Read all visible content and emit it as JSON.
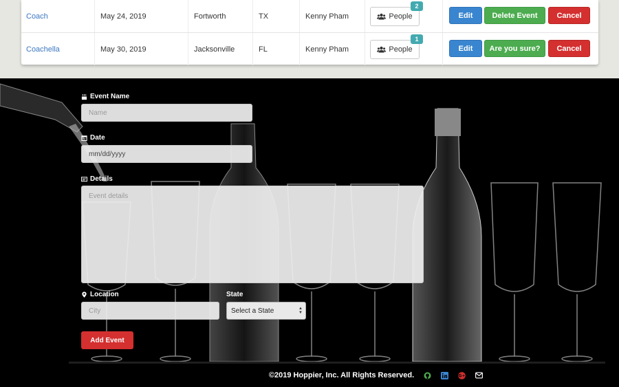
{
  "table": {
    "rows": [
      {
        "name": "Coach",
        "date": "May 24, 2019",
        "city": "Fortworth",
        "state": "TX",
        "host": "Kenny Pham",
        "people_label": "People",
        "people_count": "2",
        "edit_label": "Edit",
        "delete_label": "Delete Event",
        "cancel_label": "Cancel"
      },
      {
        "name": "Coachella",
        "date": "May 30, 2019",
        "city": "Jacksonville",
        "state": "FL",
        "host": "Kenny Pham",
        "people_label": "People",
        "people_count": "1",
        "edit_label": "Edit",
        "delete_label": "Are you sure?",
        "cancel_label": "Cancel"
      }
    ]
  },
  "form": {
    "event_name_label": "Event Name",
    "event_name_placeholder": "Name",
    "date_label": "Date",
    "date_value": "mm/dd/yyyy",
    "details_label": "Details",
    "details_placeholder": "Event details",
    "location_label": "Location",
    "city_placeholder": "City",
    "state_label": "State",
    "state_selected": "Select a State",
    "submit_label": "Add Event"
  },
  "footer": {
    "copyright": "©2019 Hoppier, Inc. All Rights Reserved.",
    "icons": [
      "github-icon",
      "linkedin-icon",
      "google-plus-icon",
      "email-icon"
    ]
  },
  "colors": {
    "link": "#3b77c2",
    "edit": "#3a85cf",
    "success": "#4cac4f",
    "danger": "#d3302f",
    "badge": "#43aab0"
  }
}
